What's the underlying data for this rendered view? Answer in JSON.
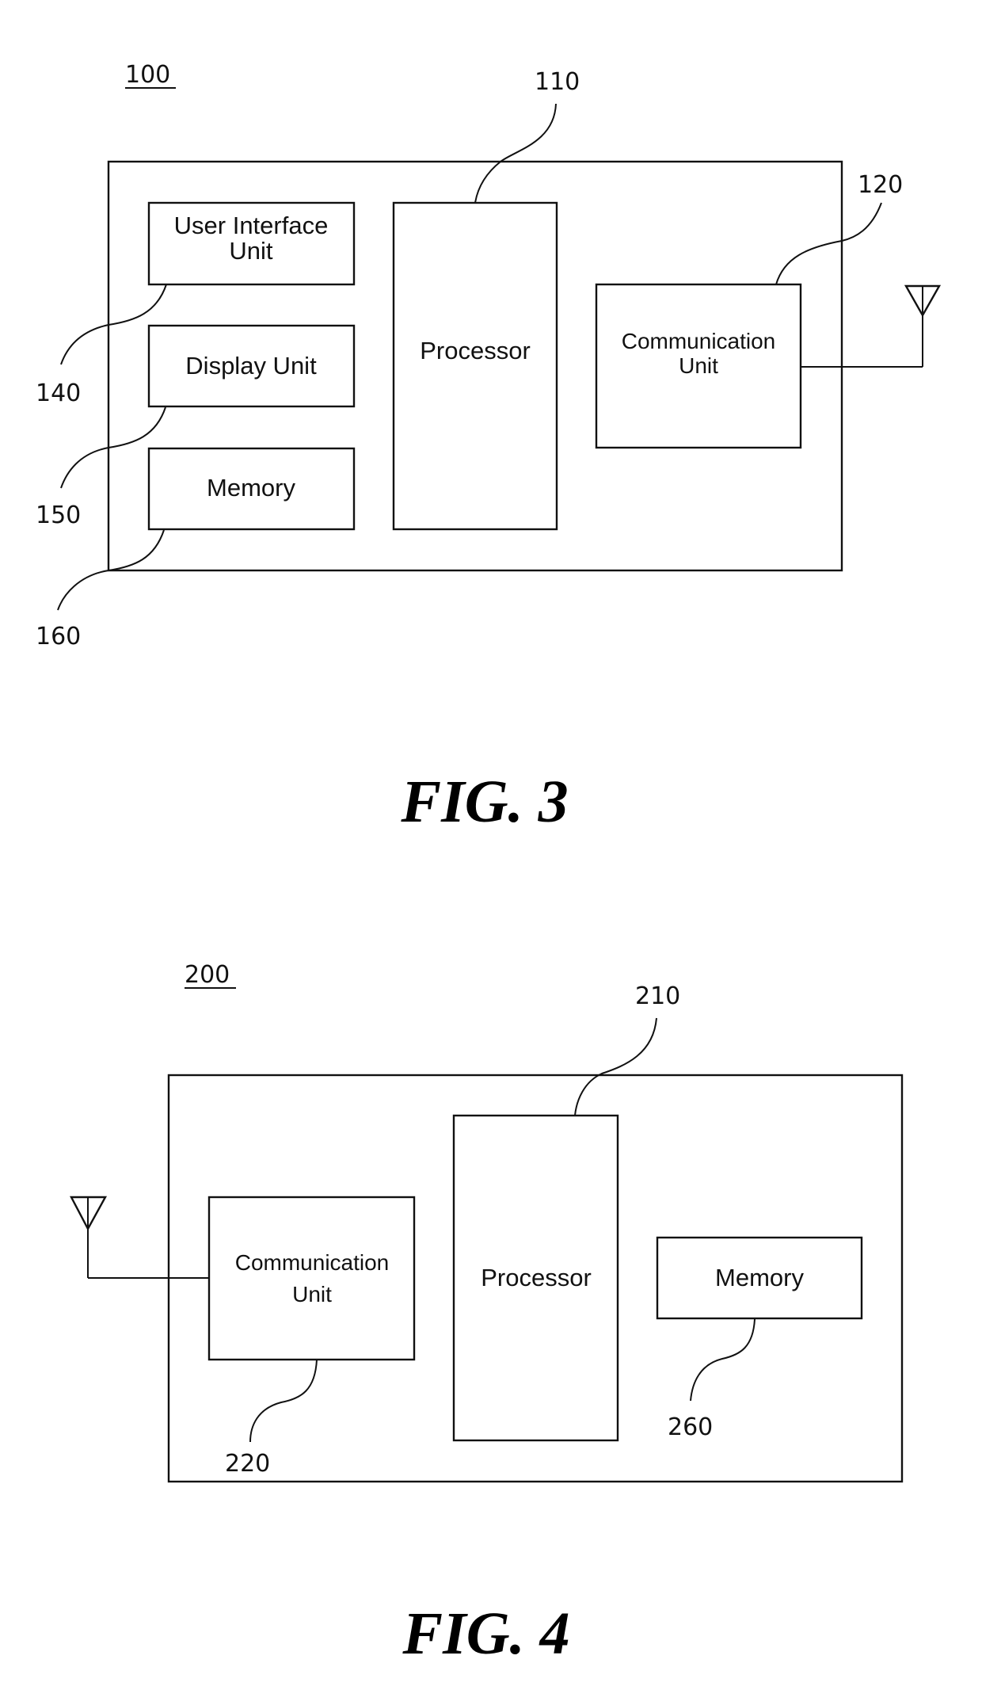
{
  "figures": [
    {
      "caption": "FIG. 3",
      "device_ref": "100",
      "blocks": {
        "user_interface": {
          "ref": "140",
          "lines": [
            "User Interface",
            "Unit"
          ]
        },
        "display": {
          "ref": "150",
          "lines": [
            "Display Unit"
          ]
        },
        "memory": {
          "ref": "160",
          "lines": [
            "Memory"
          ]
        },
        "processor": {
          "ref": "110",
          "lines": [
            "Processor"
          ]
        },
        "communication": {
          "ref": "120",
          "lines": [
            "Communication",
            "Unit"
          ]
        }
      },
      "antenna": "antenna-icon"
    },
    {
      "caption": "FIG. 4",
      "device_ref": "200",
      "blocks": {
        "communication": {
          "ref": "220",
          "lines": [
            "Communication",
            "Unit"
          ]
        },
        "processor": {
          "ref": "210",
          "lines": [
            "Processor"
          ]
        },
        "memory": {
          "ref": "260",
          "lines": [
            "Memory"
          ]
        }
      },
      "antenna": "antenna-icon"
    }
  ],
  "colors": {
    "ink": "#111111",
    "paper": "#ffffff"
  }
}
